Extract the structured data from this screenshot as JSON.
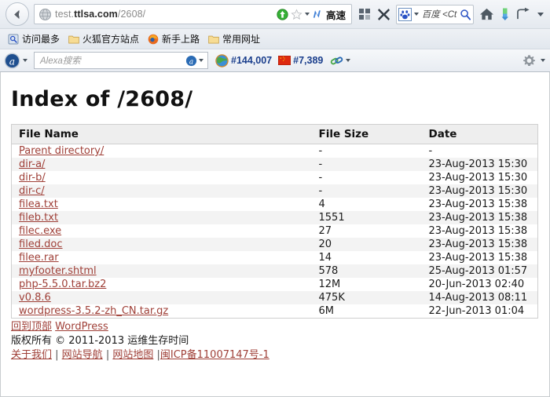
{
  "browser": {
    "back_button": "back-arrow-icon",
    "url": {
      "prefix": "test.",
      "domain": "ttlsa.com",
      "path": "/2608/",
      "full": "test.ttlsa.com/2608/"
    },
    "url_icons": {
      "download": "green-download-arrow-icon",
      "bookmark_star": "star-icon",
      "dropdown": "chevron-down-icon",
      "speed_mark": "lightning-n-icon",
      "speed_label": "高速"
    },
    "toolbar_buttons": {
      "grid": "grid-panels-icon",
      "close": "close-x-icon",
      "home": "home-icon",
      "downloads": "downloads-icon",
      "history": "history-arrow-icon",
      "overflow": "chevron-down-icon"
    },
    "search": {
      "engine_icon": "baidu-paw-icon",
      "placeholder": "百度 <Ct"
    },
    "bookmarks": [
      {
        "icon": "most-visited-icon",
        "label": "访问最多"
      },
      {
        "icon": "folder-icon",
        "label": "火狐官方站点"
      },
      {
        "icon": "firefox-icon",
        "label": "新手上路"
      },
      {
        "icon": "folder-icon",
        "label": "常用网址"
      }
    ],
    "alexa": {
      "logo": "alexa-a-icon",
      "placeholder": "Alexa搜索",
      "submit_icon": "alexa-a-icon",
      "global_icon": "globe-icon",
      "global_rank": "#144,007",
      "country_icon": "china-flag-icon",
      "country_rank": "#7,389",
      "links_icon": "link-chain-icon",
      "settings_icon": "gear-icon"
    }
  },
  "page": {
    "title": "Index of /2608/",
    "table": {
      "columns": [
        "File Name",
        "File Size",
        "Date"
      ],
      "rows": [
        {
          "name": "Parent directory/",
          "size": "-",
          "date": "-"
        },
        {
          "name": "dir-a/",
          "size": "-",
          "date": "23-Aug-2013 15:30"
        },
        {
          "name": "dir-b/",
          "size": "-",
          "date": "23-Aug-2013 15:30"
        },
        {
          "name": "dir-c/",
          "size": "-",
          "date": "23-Aug-2013 15:30"
        },
        {
          "name": "filea.txt",
          "size": "4",
          "date": "23-Aug-2013 15:38"
        },
        {
          "name": "fileb.txt",
          "size": "1551",
          "date": "23-Aug-2013 15:38"
        },
        {
          "name": "filec.exe",
          "size": "27",
          "date": "23-Aug-2013 15:38"
        },
        {
          "name": "filed.doc",
          "size": "20",
          "date": "23-Aug-2013 15:38"
        },
        {
          "name": "filee.rar",
          "size": "14",
          "date": "23-Aug-2013 15:38"
        },
        {
          "name": "myfooter.shtml",
          "size": "578",
          "date": "25-Aug-2013 01:57"
        },
        {
          "name": "php-5.5.0.tar.bz2",
          "size": "12M",
          "date": "20-Jun-2013 02:40"
        },
        {
          "name": "v0.8.6",
          "size": "475K",
          "date": "14-Aug-2013 08:11"
        },
        {
          "name": "wordpress-3.5.2-zh_CN.tar.gz",
          "size": "6M",
          "date": "22-Jun-2013 01:04"
        }
      ]
    },
    "footer": {
      "back_to_top": "回到顶部",
      "platform": "WordPress",
      "copyright": "版权所有 © 2011-2013 运维生存时间",
      "links": [
        "关于我们",
        "网站导航",
        "网站地图"
      ],
      "separator": "|",
      "icp": "闽ICP备11007147号-1"
    }
  },
  "colors": {
    "link": "#9f3f37",
    "rank_text": "#1a3e8c",
    "header_bg": "#eeeeee",
    "row_alt_bg": "#f3f3f3"
  }
}
